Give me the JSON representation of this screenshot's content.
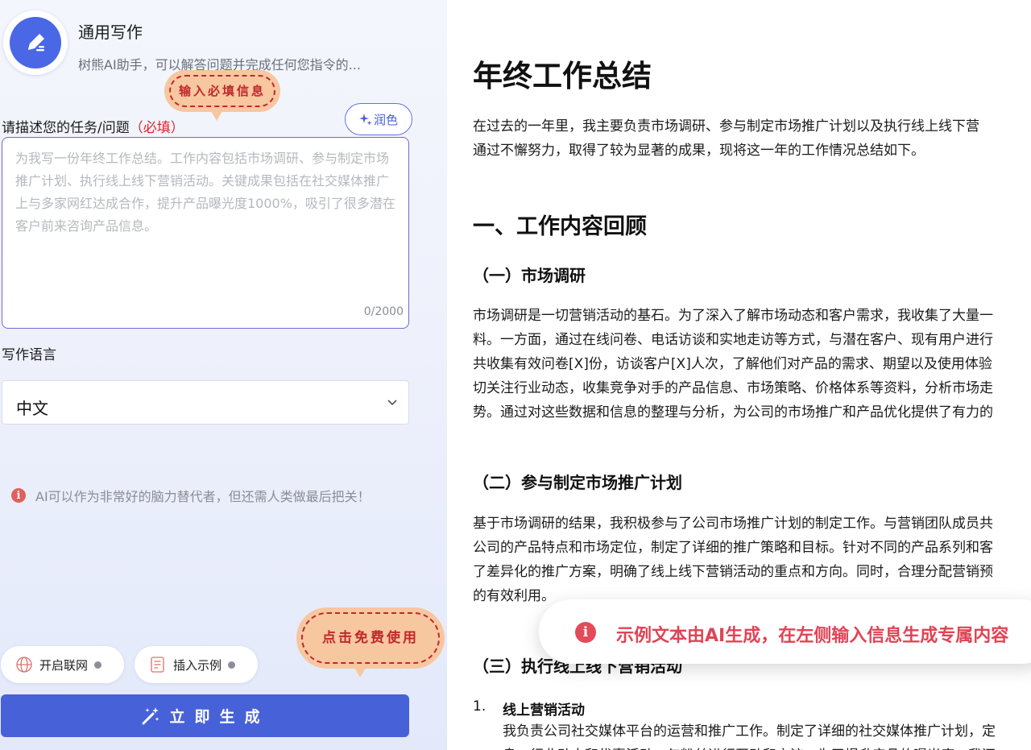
{
  "app": {
    "title": "通用写作",
    "description": "树熊AI助手，可以解答问题并完成任何您指令的..."
  },
  "annotations": {
    "input_hint": "输入必填信息",
    "use_hint": "点击免费使用"
  },
  "task": {
    "label": "请描述您的任务/问题",
    "required": "（必填）",
    "polish_label": "润色",
    "placeholder": "为我写一份年终工作总结。工作内容包括市场调研、参与制定市场推广计划、执行线上线下营销活动。关键成果包括在社交媒体推广上与多家网红达成合作，提升产品曝光度1000%，吸引了很多潜在客户前来咨询产品信息。",
    "value": "",
    "counter": "0/2000"
  },
  "language": {
    "label": "写作语言",
    "selected": "中文"
  },
  "tip": "AI可以作为非常好的脑力替代者，但还需人类做最后把关！",
  "toggles": {
    "web": "开启联网",
    "example": "插入示例"
  },
  "generate_label": "立即生成",
  "document": {
    "title": "年终工作总结",
    "intro": [
      "在过去的一年里，我主要负责市场调研、参与制定市场推广计划以及执行线上线下营",
      "通过不懈努力，取得了较为显著的成果，现将这一年的工作情况总结如下。"
    ],
    "section1": "一、工作内容回顾",
    "sub1": "（一）市场调研",
    "sub1_para": [
      "市场调研是一切营销活动的基石。为了深入了解市场动态和客户需求，我收集了大量一",
      "料。一方面，通过在线问卷、电话访谈和实地走访等方式，与潜在客户、现有用户进行",
      "共收集有效问卷[X]份，访谈客户[X]人次，了解他们对产品的需求、期望以及使用体验",
      "切关注行业动态，收集竞争对手的产品信息、市场策略、价格体系等资料，分析市场走",
      "势。通过对这些数据和信息的整理与分析，为公司的市场推广和产品优化提供了有力的"
    ],
    "sub2": "（二）参与制定市场推广计划",
    "sub2_para": [
      "基于市场调研的结果，我积极参与了公司市场推广计划的制定工作。与营销团队成员共",
      "公司的产品特点和市场定位，制定了详细的推广策略和目标。针对不同的产品系列和客",
      "了差异化的推广方案，明确了线上线下营销活动的重点和方向。同时，合理分配营销预",
      "的有效利用。"
    ],
    "sub3": "（三）执行线上线下营销活动",
    "list_num": "1.",
    "list_title": "线上营销活动",
    "list_para": [
      "我负责公司社交媒体平台的运营和推广工作。制定了详细的社交媒体推广计划，定",
      "息、行业动态和优惠活动，与粉丝进行互动和交流，为了提升产品的曝光度，我还"
    ]
  },
  "toast": "示例文本由AI生成，在左侧输入信息生成专属内容"
}
